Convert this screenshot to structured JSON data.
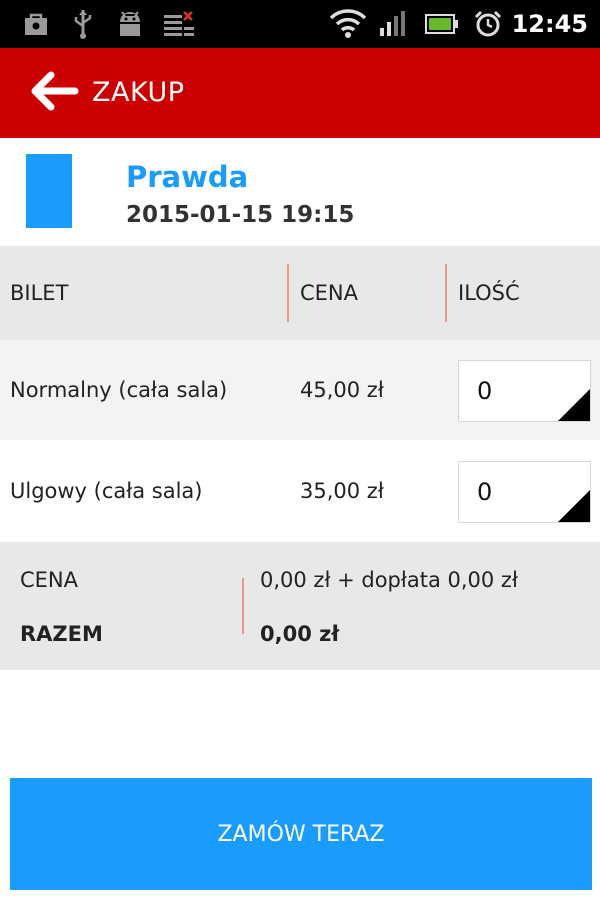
{
  "status_bar": {
    "time": "12:45",
    "icons": [
      "shopping-bag-icon",
      "usb-icon",
      "android-debug-icon",
      "download-list-icon",
      "wifi-icon",
      "signal-icon",
      "battery-icon",
      "alarm-icon"
    ]
  },
  "action_bar": {
    "title": "ZAKUP",
    "back_icon": "arrow-left-icon",
    "background": "#cc0000"
  },
  "event": {
    "title": "Prawda",
    "datetime": "2015-01-15 19:15",
    "accent": "#1a9cff"
  },
  "table": {
    "headers": {
      "ticket": "BILET",
      "price": "CENA",
      "quantity": "ILOŚĆ"
    },
    "rows": [
      {
        "name": "Normalny (cała sala)",
        "price": "45,00 zł",
        "quantity": "0"
      },
      {
        "name": "Ulgowy (cała sala)",
        "price": "35,00 zł",
        "quantity": "0"
      }
    ]
  },
  "summary": {
    "price_label": "CENA",
    "price_value": "0,00 zł + dopłata 0,00 zł",
    "total_label": "RAZEM",
    "total_value": "0,00 zł"
  },
  "order_button": {
    "label": "ZAMÓW TERAZ",
    "color": "#1a9cff"
  }
}
